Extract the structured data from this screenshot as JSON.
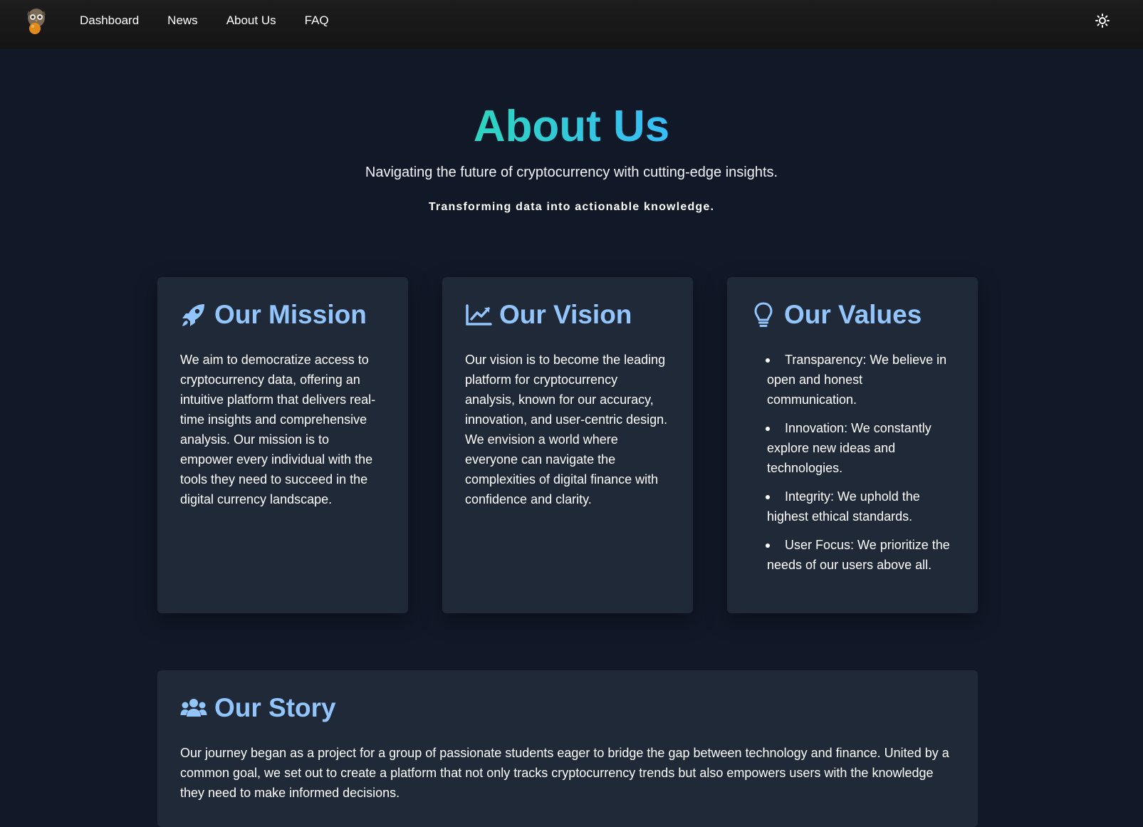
{
  "nav": {
    "logo_alt": "owl logo",
    "links": [
      {
        "label": "Dashboard"
      },
      {
        "label": "News"
      },
      {
        "label": "About Us"
      },
      {
        "label": "FAQ"
      }
    ],
    "theme_icon": "sun-icon"
  },
  "hero": {
    "title": "About Us",
    "subtitle": "Navigating the future of cryptocurrency with cutting-edge insights.",
    "tagline": "Transforming data into actionable knowledge."
  },
  "cards": {
    "mission": {
      "icon": "rocket-icon",
      "title": "Our Mission",
      "body": "We aim to democratize access to cryptocurrency data, offering an intuitive platform that delivers real-time insights and comprehensive analysis. Our mission is to empower every individual with the tools they need to succeed in the digital currency landscape."
    },
    "vision": {
      "icon": "chart-line-icon",
      "title": "Our Vision",
      "body": "Our vision is to become the leading platform for cryptocurrency analysis, known for our accuracy, innovation, and user-centric design. We envision a world where everyone can navigate the complexities of digital finance with confidence and clarity."
    },
    "values": {
      "icon": "lightbulb-icon",
      "title": "Our Values",
      "items": [
        "Transparency: We believe in open and honest communication.",
        "Innovation: We constantly explore new ideas and technologies.",
        "Integrity: We uphold the highest ethical standards.",
        "User Focus: We prioritize the needs of our users above all."
      ]
    }
  },
  "story": {
    "icon": "users-icon",
    "title": "Our Story",
    "body": "Our journey began as a project for a group of passionate students eager to bridge the gap between technology and finance. United by a common goal, we set out to create a platform that not only tracks cryptocurrency trends but also empowers users with the knowledge they need to make informed decisions."
  },
  "colors": {
    "background": "#111827",
    "card": "#1f2937",
    "accent_title": "#93c5fd",
    "gradient_start": "#2dd4bf",
    "gradient_end": "#38bdf8"
  }
}
